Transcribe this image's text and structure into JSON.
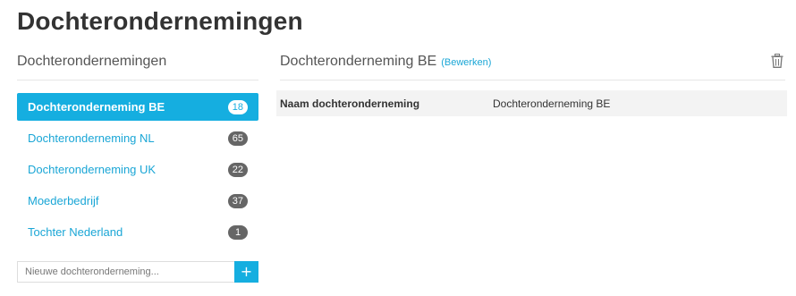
{
  "page": {
    "title": "Dochterondernemingen"
  },
  "sidebar": {
    "heading": "Dochterondernemingen",
    "items": [
      {
        "label": "Dochteronderneming BE",
        "count": "18",
        "active": true
      },
      {
        "label": "Dochteronderneming NL",
        "count": "65",
        "active": false
      },
      {
        "label": "Dochteronderneming UK",
        "count": "22",
        "active": false
      },
      {
        "label": "Moederbedrijf",
        "count": "37",
        "active": false
      },
      {
        "label": "Tochter Nederland",
        "count": "1",
        "active": false
      }
    ],
    "new_placeholder": "Nieuwe dochteronderneming...",
    "add_label": "+"
  },
  "detail": {
    "title": "Dochteronderneming BE",
    "edit_label": "(Bewerken)",
    "delete_icon": "trash-icon",
    "fields": [
      {
        "label": "Naam dochteronderneming",
        "value": "Dochteronderneming BE"
      }
    ]
  },
  "colors": {
    "accent": "#15aee0",
    "link": "#1aa6d6",
    "badge": "#666666"
  }
}
